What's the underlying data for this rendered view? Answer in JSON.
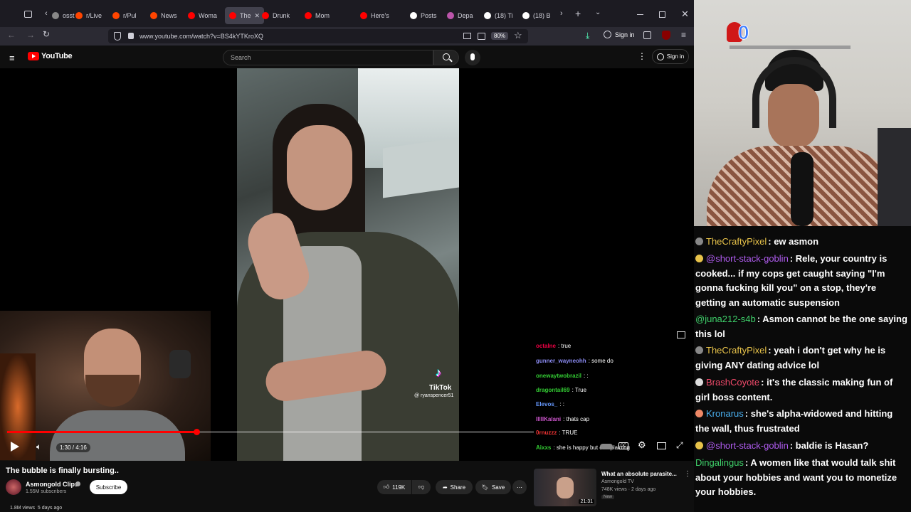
{
  "browser": {
    "tabs": [
      {
        "label": "osst",
        "color": "#888"
      },
      {
        "label": "r/Live",
        "color": "#ff4500"
      },
      {
        "label": "r/Pul",
        "color": "#ff4500"
      },
      {
        "label": "News",
        "color": "#ff4500"
      },
      {
        "label": "Woma",
        "color": "#f00"
      },
      {
        "label": "The",
        "color": "#f00"
      },
      {
        "label": "Drunk",
        "color": "#f00"
      },
      {
        "label": "Mom",
        "color": "#f00"
      },
      {
        "label": "Here's",
        "color": "#f00"
      },
      {
        "label": "Posts",
        "color": "#fff"
      },
      {
        "label": "Depa",
        "color": "#b5a"
      },
      {
        "label": "(18) Ti",
        "color": "#fff"
      },
      {
        "label": "(18) B",
        "color": "#fff"
      }
    ],
    "url": "www.youtube.com/watch?v=BS4kYTKroXQ",
    "zoom": "80%",
    "sign_in": "Sign in"
  },
  "youtube": {
    "logo_text": "YouTube",
    "search_placeholder": "Search",
    "sign_in": "Sign in",
    "video_title": "The bubble is finally bursting..",
    "channel_name": "Asmongold Clips",
    "subscribers": "1.55M subscribers",
    "subscribe": "Subscribe",
    "likes": "119K",
    "share": "Share",
    "save": "Save",
    "views_date": "1.8M views  5 days ago",
    "time": "1:30 / 4:16",
    "progress": 0.36,
    "tiktok_label": "TikTok",
    "tiktok_handle": "@ ryanspencer51",
    "rec": {
      "title": "What an absolute parasite...",
      "channel": "Asmongold TV",
      "meta": "748K views · 2 days ago",
      "badge": "New",
      "duration": "21:31"
    },
    "overlay_chat": [
      {
        "user": "octalne",
        "text": "true",
        "color": "#e04"
      },
      {
        "user": "gunner_wayneohh",
        "text": "some do",
        "color": "#8a8af0"
      },
      {
        "user": "onewaytwobrazil",
        "text": ":",
        "color": "#3c3"
      },
      {
        "user": "dragontail69",
        "text": "True",
        "color": "#3c3"
      },
      {
        "user": "Elevos_",
        "text": ":",
        "color": "#69f"
      },
      {
        "user": "lllllKalani",
        "text": "thats cap",
        "color": "#c5c"
      },
      {
        "user": "0rnuzzz",
        "text": "TRUE",
        "color": "#e33"
      },
      {
        "user": "Aixxs",
        "text": "she is happy but complaining",
        "color": "#3c3"
      }
    ]
  },
  "stream": {
    "counter": "0",
    "chat": [
      {
        "user": "TheCraftyPixel",
        "text": ": ew asmon",
        "color": "#e8c34a",
        "badge": "#888"
      },
      {
        "user": "@short-stack-goblin",
        "text": ": Rele, your country is cooked... if my cops get caught saying \"I'm gonna fucking kill you\" on a stop, they're getting an automatic suspension",
        "color": "#b05cf0",
        "badge": "#e8c34a"
      },
      {
        "user": "@juna212-s4b",
        "text": ": Asmon cannot be the one saying this lol",
        "color": "#3fd06a",
        "badge": ""
      },
      {
        "user": "TheCraftyPixel",
        "text": ": yeah i don't get why he is giving ANY dating advice lol",
        "color": "#e8c34a",
        "badge": "#888"
      },
      {
        "user": "BrashCoyote",
        "text": ": it's the classic making fun of girl boss content.",
        "color": "#f04a6a",
        "badge": "#ddd"
      },
      {
        "user": "Kronarus",
        "text": ": she's alpha-widowed and hitting the wall, thus frustrated",
        "color": "#4ab0f0",
        "badge": "#e86"
      },
      {
        "user": "@short-stack-goblin",
        "text": ": baldie is Hasan?",
        "color": "#b05cf0",
        "badge": "#e8c34a"
      },
      {
        "user": "Dingalingus",
        "text": ": A women like that would talk shit about your hobbies and want you to monetize your hobbies.",
        "color": "#3fd06a",
        "badge": ""
      }
    ]
  }
}
